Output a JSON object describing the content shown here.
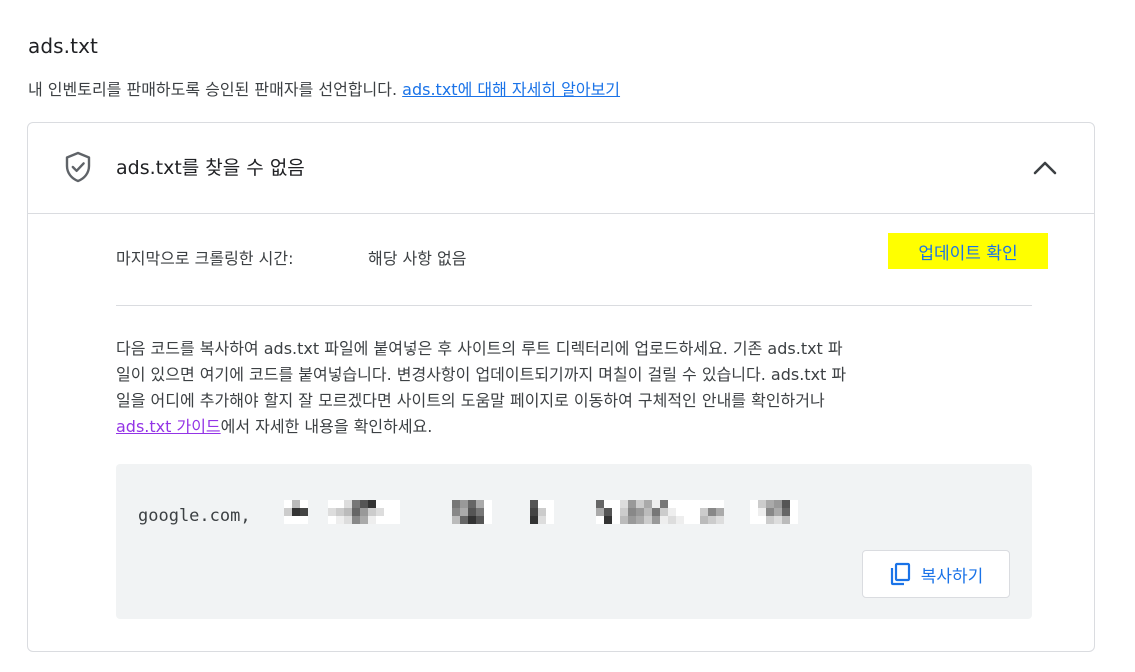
{
  "header": {
    "title": "ads.txt",
    "description": "내 인벤토리를 판매하도록 승인된 판매자를 선언합니다. ",
    "learn_more_link": "ads.txt에 대해 자세히 알아보기"
  },
  "status_card": {
    "status_title": "ads.txt를 찾을 수 없음",
    "status_icon": "shield-check-icon",
    "collapse_icon": "chevron-up-icon",
    "last_crawled_label": "마지막으로 크롤링한 시간:",
    "last_crawled_value": "해당 사항 없음",
    "check_update_label": "업데이트 확인",
    "instructions": {
      "line1": "다음 코드를 복사하여 ads.txt 파일에 붙여넣은 후 사이트의 루트 디렉터리에 업로드하세요. 기존 ads.txt 파",
      "line2": "일이 있으면 여기에 코드를 붙여넣습니다. 변경사항이 업데이트되기까지 며칠이 걸릴 수 있습니다. ads.txt 파",
      "line3": "일을 어디에 추가해야 할지 잘 모르겠다면 사이트의 도움말 페이지로 이동하여 구체적인 안내를 확인하거나",
      "guide_link": "ads.txt 가이드",
      "line4_rest": "에서 자세한 내용을 확인하세요."
    },
    "code_snippet": {
      "visible_text": "google.com,"
    },
    "copy_button_label": "복사하기",
    "copy_icon": "copy-icon"
  },
  "colors": {
    "link_blue": "#1a73e8",
    "visited_link_purple": "#9334e6",
    "highlight_yellow": "#ffff00",
    "border_gray": "#dadce0",
    "code_bg": "#f1f3f4"
  }
}
